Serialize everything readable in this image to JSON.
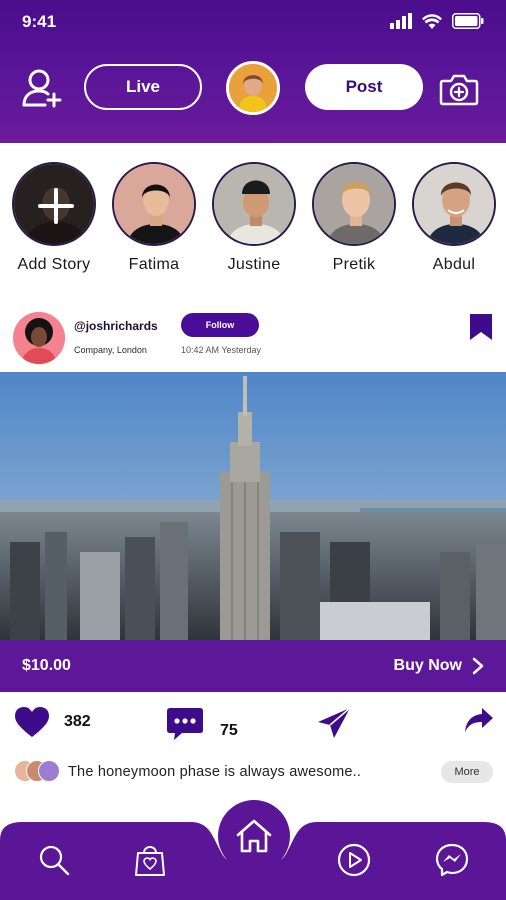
{
  "status_bar": {
    "time": "9:41",
    "icons": [
      "signal-icon",
      "wifi-icon",
      "battery-icon"
    ]
  },
  "top_bar": {
    "live_label": "Live",
    "post_label": "Post"
  },
  "stories": [
    {
      "name": "Add Story"
    },
    {
      "name": "Fatima"
    },
    {
      "name": "Justine"
    },
    {
      "name": "Pretik"
    },
    {
      "name": "Abdul"
    }
  ],
  "post": {
    "handle": "@joshrichards",
    "follow_label": "Follow",
    "location": "Company, London",
    "time": "10:42 AM Yesterday",
    "price": "$10.00",
    "buy_label": "Buy Now",
    "likes": "382",
    "comments": "75",
    "caption": "The honeymoon phase is always awesome..",
    "more_label": "More"
  },
  "colors": {
    "primary": "#5d1799",
    "primary_dark": "#3a0d7a",
    "accent_gradient_top": "#4a0d8c"
  },
  "bottom_nav": {
    "items": [
      "search-icon",
      "shopping-bag-icon",
      "home-icon",
      "play-icon",
      "messenger-icon"
    ]
  }
}
